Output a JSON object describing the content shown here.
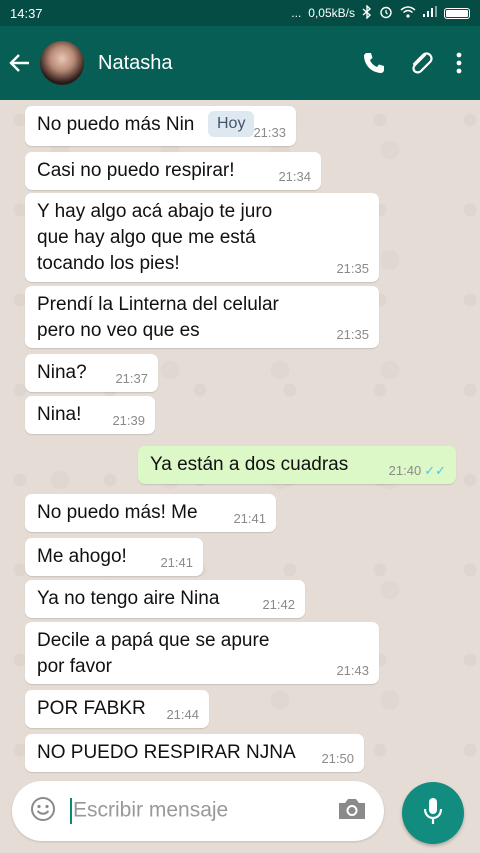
{
  "status_bar": {
    "time": "14:37",
    "dots": "...",
    "network_speed": "0,05kB/s"
  },
  "header": {
    "contact_name": "Natasha"
  },
  "chat": {
    "date_label": "Hoy",
    "messages": [
      {
        "direction": "in",
        "text": "No puedo más Nin",
        "time": "21:33"
      },
      {
        "direction": "in",
        "text": "Casi no puedo respirar!",
        "time": "21:34"
      },
      {
        "direction": "in",
        "text": "Y hay algo acá abajo te juro\nque hay algo que me está\ntocando los pies!",
        "time": "21:35"
      },
      {
        "direction": "in",
        "text": "Prendí la Linterna del celular\npero no veo que es",
        "time": "21:35"
      },
      {
        "direction": "in",
        "text": "Nina?",
        "time": "21:37"
      },
      {
        "direction": "in",
        "text": "Nina!",
        "time": "21:39"
      },
      {
        "direction": "out",
        "text": "Ya están a dos cuadras",
        "time": "21:40",
        "status": "read"
      },
      {
        "direction": "in",
        "text": "No puedo más! Me",
        "time": "21:41"
      },
      {
        "direction": "in",
        "text": "Me ahogo!",
        "time": "21:41"
      },
      {
        "direction": "in",
        "text": "Ya no tengo aire Nina",
        "time": "21:42"
      },
      {
        "direction": "in",
        "text": "Decile a papá que se apure\npor favor",
        "time": "21:43"
      },
      {
        "direction": "in",
        "text": "POR FABKR",
        "time": "21:44"
      },
      {
        "direction": "in",
        "text": "NO PUEDO RESPIRAR NJNA",
        "time": "21:50"
      }
    ]
  },
  "composer": {
    "placeholder": "Escribir mensaje"
  },
  "colors": {
    "header": "#075e54",
    "status_bar": "#054d44",
    "outgoing_bubble": "#dcf8c6",
    "incoming_bubble": "#ffffff",
    "chat_background": "#e5ddd5",
    "read_ticks": "#4fc3f7",
    "mic_button": "#128c7e"
  },
  "icons": [
    "back-arrow-icon",
    "phone-icon",
    "paperclip-icon",
    "more-vert-icon",
    "emoji-icon",
    "camera-icon",
    "mic-icon",
    "bluetooth-icon",
    "alarm-icon",
    "wifi-icon",
    "signal-icon",
    "battery-icon"
  ]
}
